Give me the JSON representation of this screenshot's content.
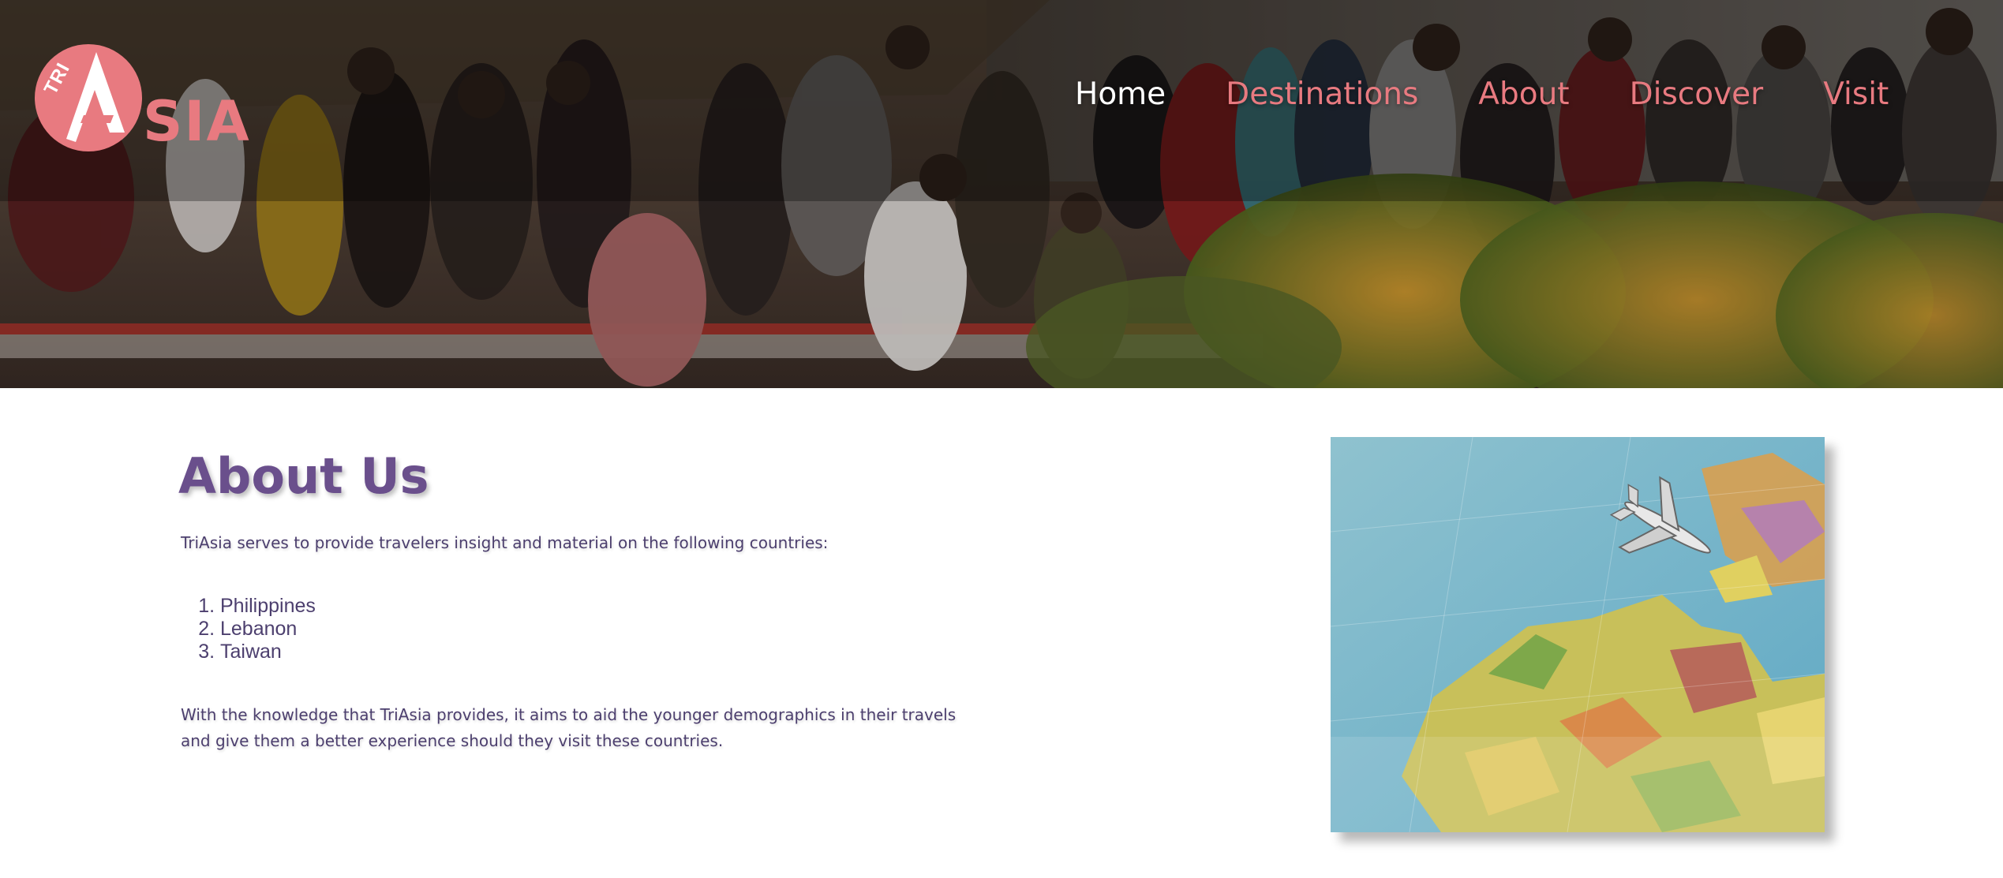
{
  "logo": {
    "tri": "TRI",
    "sia": "SIA",
    "color": "#e87a80"
  },
  "nav": {
    "items": [
      {
        "label": "Home",
        "active": true
      },
      {
        "label": "Destinations",
        "active": false
      },
      {
        "label": "About",
        "active": false
      },
      {
        "label": "Discover",
        "active": false
      },
      {
        "label": "Visit",
        "active": false
      }
    ]
  },
  "about": {
    "title": "About Us",
    "intro": "TriAsia serves to provide travelers insight and material on the following countries:",
    "countries": [
      "Philippines",
      "Lebanon",
      "Taiwan"
    ],
    "closing": "With the knowledge that TriAsia provides, it aims to aid the younger demographics in their travels and give them a better experience should they visit these countries."
  },
  "images": {
    "hero": "crowd-at-viewpoint-photo",
    "map": "world-map-with-toy-airplane-photo"
  },
  "colors": {
    "accent": "#e87a80",
    "heading": "#6a4f8c",
    "body_text": "#4c3f6e",
    "nav_active": "#ffffff"
  }
}
